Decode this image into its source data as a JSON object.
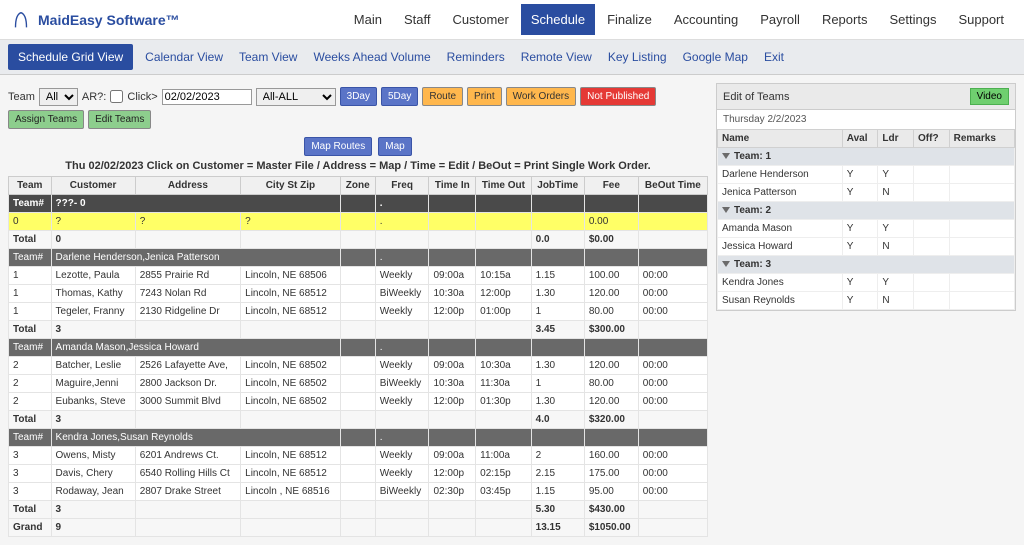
{
  "header": {
    "brand": "MaidEasy Software™"
  },
  "topnav": [
    "Main",
    "Staff",
    "Customer",
    "Schedule",
    "Finalize",
    "Accounting",
    "Payroll",
    "Reports",
    "Settings",
    "Support"
  ],
  "topnav_active": "Schedule",
  "subbar": {
    "grid_view": "Schedule Grid View",
    "links": [
      "Calendar View",
      "Team View",
      "Weeks Ahead Volume",
      "Reminders",
      "Remote View",
      "Key Listing",
      "Google Map",
      "Exit"
    ]
  },
  "controls": {
    "team_label": "Team",
    "team_value": "All",
    "ar_label": "AR?:",
    "click_label": "Click>",
    "date_value": "02/02/2023",
    "all_value": "All-ALL",
    "btn_3day": "3Day",
    "btn_5day": "5Day",
    "btn_route": "Route",
    "btn_print": "Print",
    "btn_work_orders": "Work Orders",
    "btn_not_published": "Not Published",
    "btn_assign_teams": "Assign Teams",
    "btn_edit_teams": "Edit Teams",
    "btn_map_routes": "Map Routes",
    "btn_map": "Map"
  },
  "hint": "Thu 02/02/2023 Click on Customer = Master File / Address = Map / Time = Edit / BeOut = Print Single Work Order.",
  "columns": [
    "Team",
    "Customer",
    "Address",
    "City St Zip",
    "Zone",
    "Freq",
    "Time In",
    "Time Out",
    "JobTime",
    "Fee",
    "BeOut Time"
  ],
  "blocks": [
    {
      "team_header": {
        "team": "Team#",
        "desc": "???- 0"
      },
      "yellow_row": {
        "team": "0",
        "customer": "?",
        "address": "?",
        "city": "?",
        "zone": "",
        "freq": ".",
        "timein": "",
        "timeout": "",
        "jobtime": "",
        "fee": "0.00",
        "beout": ""
      },
      "total": {
        "label": "Total",
        "count": "0",
        "jobtime": "0.0",
        "fee": "$0.00"
      }
    },
    {
      "team_header": {
        "team": "Team#",
        "desc": "Darlene Henderson,Jenica Patterson"
      },
      "rows": [
        {
          "team": "1",
          "customer": "Lezotte, Paula",
          "address": "2855 Prairie Rd",
          "city": "Lincoln, NE 68506",
          "zone": "",
          "freq": "Weekly",
          "timein": "09:00a",
          "timeout": "10:15a",
          "jobtime": "1.15",
          "fee": "100.00",
          "beout": "00:00"
        },
        {
          "team": "1",
          "customer": "Thomas, Kathy",
          "address": "7243 Nolan Rd",
          "city": "Lincoln, NE 68512",
          "zone": "",
          "freq": "BiWeekly",
          "timein": "10:30a",
          "timeout": "12:00p",
          "jobtime": "1.30",
          "fee": "120.00",
          "beout": "00:00"
        },
        {
          "team": "1",
          "customer": "Tegeler, Franny",
          "address": "2130 Ridgeline Dr",
          "city": "Lincoln, NE 68512",
          "zone": "",
          "freq": "Weekly",
          "timein": "12:00p",
          "timeout": "01:00p",
          "jobtime": "1",
          "fee": "80.00",
          "beout": "00:00"
        }
      ],
      "total": {
        "label": "Total",
        "count": "3",
        "jobtime": "3.45",
        "fee": "$300.00"
      }
    },
    {
      "team_header": {
        "team": "Team#",
        "desc": "Amanda Mason,Jessica Howard"
      },
      "rows": [
        {
          "team": "2",
          "customer": "Batcher, Leslie",
          "address": "2526 Lafayette Ave,",
          "city": "Lincoln, NE 68502",
          "zone": "",
          "freq": "Weekly",
          "timein": "09:00a",
          "timeout": "10:30a",
          "jobtime": "1.30",
          "fee": "120.00",
          "beout": "00:00"
        },
        {
          "team": "2",
          "customer": "Maguire,Jenni",
          "address": "2800 Jackson Dr.",
          "city": "Lincoln, NE 68502",
          "zone": "",
          "freq": "BiWeekly",
          "timein": "10:30a",
          "timeout": "11:30a",
          "jobtime": "1",
          "fee": "80.00",
          "beout": "00:00"
        },
        {
          "team": "2",
          "customer": "Eubanks, Steve",
          "address": "3000 Summit Blvd",
          "city": "Lincoln, NE 68502",
          "zone": "",
          "freq": "Weekly",
          "timein": "12:00p",
          "timeout": "01:30p",
          "jobtime": "1.30",
          "fee": "120.00",
          "beout": "00:00"
        }
      ],
      "total": {
        "label": "Total",
        "count": "3",
        "jobtime": "4.0",
        "fee": "$320.00"
      }
    },
    {
      "team_header": {
        "team": "Team#",
        "desc": "Kendra Jones,Susan Reynolds"
      },
      "rows": [
        {
          "team": "3",
          "customer": "Owens, Misty",
          "address": "6201 Andrews Ct.",
          "city": "Lincoln, NE 68512",
          "zone": "",
          "freq": "Weekly",
          "timein": "09:00a",
          "timeout": "11:00a",
          "jobtime": "2",
          "fee": "160.00",
          "beout": "00:00"
        },
        {
          "team": "3",
          "customer": "Davis, Chery",
          "address": "6540 Rolling Hills Ct",
          "city": "Lincoln, NE 68512",
          "zone": "",
          "freq": "Weekly",
          "timein": "12:00p",
          "timeout": "02:15p",
          "jobtime": "2.15",
          "fee": "175.00",
          "beout": "00:00"
        },
        {
          "team": "3",
          "customer": "Rodaway, Jean",
          "address": "2807 Drake Street",
          "city": "Lincoln , NE 68516",
          "zone": "",
          "freq": "BiWeekly",
          "timein": "02:30p",
          "timeout": "03:45p",
          "jobtime": "1.15",
          "fee": "95.00",
          "beout": "00:00"
        }
      ],
      "total": {
        "label": "Total",
        "count": "3",
        "jobtime": "5.30",
        "fee": "$430.00"
      }
    }
  ],
  "grand": {
    "label": "Grand",
    "count": "9",
    "jobtime": "13.15",
    "fee": "$1050.00"
  },
  "panel": {
    "title": "Edit of Teams",
    "video": "Video",
    "date": "Thursday 2/2/2023",
    "cols": [
      "Name",
      "Aval",
      "Ldr",
      "Off?",
      "Remarks"
    ],
    "groups": [
      {
        "label": "Team: 1",
        "members": [
          {
            "name": "Darlene Henderson",
            "aval": "Y",
            "ldr": "Y",
            "off": "",
            "rem": ""
          },
          {
            "name": "Jenica Patterson",
            "aval": "Y",
            "ldr": "N",
            "off": "",
            "rem": ""
          }
        ]
      },
      {
        "label": "Team: 2",
        "members": [
          {
            "name": "Amanda Mason",
            "aval": "Y",
            "ldr": "Y",
            "off": "",
            "rem": ""
          },
          {
            "name": "Jessica Howard",
            "aval": "Y",
            "ldr": "N",
            "off": "",
            "rem": ""
          }
        ]
      },
      {
        "label": "Team: 3",
        "members": [
          {
            "name": "Kendra Jones",
            "aval": "Y",
            "ldr": "Y",
            "off": "",
            "rem": ""
          },
          {
            "name": "Susan Reynolds",
            "aval": "Y",
            "ldr": "N",
            "off": "",
            "rem": ""
          }
        ]
      }
    ]
  }
}
